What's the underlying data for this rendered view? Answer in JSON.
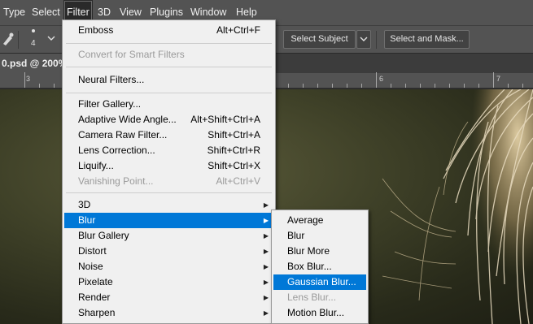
{
  "menubar": {
    "items": [
      {
        "label": "Type"
      },
      {
        "label": "Select"
      },
      {
        "label": "Filter"
      },
      {
        "label": "3D"
      },
      {
        "label": "View"
      },
      {
        "label": "Plugins"
      },
      {
        "label": "Window"
      },
      {
        "label": "Help"
      }
    ]
  },
  "options": {
    "size_value": "4",
    "select_subject": "Select Subject",
    "select_and_mask": "Select and Mask..."
  },
  "document": {
    "tab_label": "0.psd @ 200% ("
  },
  "ruler": {
    "labels": [
      "3",
      "4",
      "5",
      "6",
      "7"
    ]
  },
  "filter_menu": {
    "emboss": {
      "label": "Emboss",
      "shortcut": "Alt+Ctrl+F"
    },
    "convert": {
      "label": "Convert for Smart Filters"
    },
    "neural": {
      "label": "Neural Filters..."
    },
    "gallery": {
      "label": "Filter Gallery..."
    },
    "adaptive": {
      "label": "Adaptive Wide Angle...",
      "shortcut": "Alt+Shift+Ctrl+A"
    },
    "camera_raw": {
      "label": "Camera Raw Filter...",
      "shortcut": "Shift+Ctrl+A"
    },
    "lens_correction": {
      "label": "Lens Correction...",
      "shortcut": "Shift+Ctrl+R"
    },
    "liquify": {
      "label": "Liquify...",
      "shortcut": "Shift+Ctrl+X"
    },
    "vanishing": {
      "label": "Vanishing Point...",
      "shortcut": "Alt+Ctrl+V"
    },
    "submenus": [
      {
        "label": "3D"
      },
      {
        "label": "Blur"
      },
      {
        "label": "Blur Gallery"
      },
      {
        "label": "Distort"
      },
      {
        "label": "Noise"
      },
      {
        "label": "Pixelate"
      },
      {
        "label": "Render"
      },
      {
        "label": "Sharpen"
      }
    ]
  },
  "blur_submenu": {
    "items": [
      {
        "label": "Average"
      },
      {
        "label": "Blur"
      },
      {
        "label": "Blur More"
      },
      {
        "label": "Box Blur..."
      },
      {
        "label": "Gaussian Blur..."
      },
      {
        "label": "Lens Blur..."
      },
      {
        "label": "Motion Blur..."
      }
    ]
  },
  "colors": {
    "highlight": "#0078d7",
    "menu_bg": "#f0f0f0",
    "app_chrome": "#535353"
  }
}
